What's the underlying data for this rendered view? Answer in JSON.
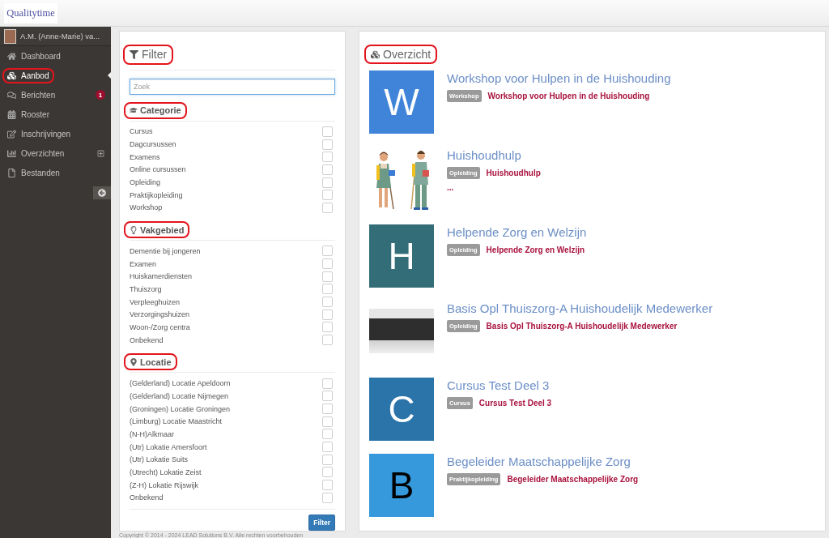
{
  "header": {
    "logo": "Qualitytime"
  },
  "sidebar": {
    "user": {
      "name": "A.M. (Anne-Marie) va..."
    },
    "items": [
      {
        "label": "Dashboard",
        "selected": false,
        "highlighted": false
      },
      {
        "label": "Aanbod",
        "selected": true,
        "highlighted": true
      },
      {
        "label": "Berichten",
        "selected": false,
        "highlighted": false,
        "badge": "1"
      },
      {
        "label": "Rooster",
        "selected": false,
        "highlighted": false
      },
      {
        "label": "Inschrijvingen",
        "selected": false,
        "highlighted": false
      },
      {
        "label": "Overzichten",
        "selected": false,
        "highlighted": false,
        "submenu": {
          "expanded": false
        }
      },
      {
        "label": "Bestanden",
        "selected": false,
        "highlighted": false
      }
    ]
  },
  "filter": {
    "title": "Filter",
    "highlighted": true,
    "search": {
      "placeholder": "Zoek",
      "focused": true
    },
    "sections": [
      {
        "title": "Categorie",
        "highlighted": true,
        "options": [
          {
            "label": "Cursus",
            "checked": false
          },
          {
            "label": "Dagcursussen",
            "checked": false
          },
          {
            "label": "Examens",
            "checked": false
          },
          {
            "label": "Online cursussen",
            "checked": false
          },
          {
            "label": "Opleiding",
            "checked": false
          },
          {
            "label": "Praktijkopleiding",
            "checked": false
          },
          {
            "label": "Workshop",
            "checked": false
          }
        ]
      },
      {
        "title": "Vakgebied",
        "highlighted": true,
        "options": [
          {
            "label": "Dementie bij jongeren",
            "checked": false
          },
          {
            "label": "Examen",
            "checked": false
          },
          {
            "label": "Huiskamerdiensten",
            "checked": false
          },
          {
            "label": "Thuiszorg",
            "checked": false
          },
          {
            "label": "Verpleeghuizen",
            "checked": false
          },
          {
            "label": "Verzorgingshuizen",
            "checked": false
          },
          {
            "label": "Woon-/Zorg centra",
            "checked": false
          },
          {
            "label": "Onbekend",
            "checked": false
          }
        ]
      },
      {
        "title": "Locatie",
        "highlighted": true,
        "options": [
          {
            "label": "(Gelderland) Locatie Apeldoorn",
            "checked": false
          },
          {
            "label": "(Gelderland) Locatie Nijmegen",
            "checked": false
          },
          {
            "label": "(Groningen) Locatie Groningen",
            "checked": false
          },
          {
            "label": "(Limburg) Locatie Maastricht",
            "checked": false
          },
          {
            "label": "(N-H)Alkmaar",
            "checked": false
          },
          {
            "label": "(Utr) Lokatie Amersfoort",
            "checked": false
          },
          {
            "label": "(Utr) Lokatie Suits",
            "checked": false
          },
          {
            "label": "(Utrecht) Lokatie Zeist",
            "checked": false
          },
          {
            "label": "(Z-H) Lokatie Rijswijk",
            "checked": false
          },
          {
            "label": "Onbekend",
            "checked": false
          }
        ]
      }
    ],
    "button": "Filter"
  },
  "overview": {
    "title": "Overzicht",
    "highlighted": true,
    "items": [
      {
        "thumbnail": {
          "kind": "letter",
          "letter": "W",
          "color": "#3f84d9",
          "dark_letter": false
        },
        "title": "Workshop voor Hulpen in de Huishouding",
        "badge": "Workshop",
        "link": "Workshop voor Hulpen in de Huishouding"
      },
      {
        "thumbnail": {
          "kind": "illustration"
        },
        "title": "Huishoudhulp",
        "badge": "Opleiding",
        "link": "Huishoudhulp",
        "excerpt": "..."
      },
      {
        "thumbnail": {
          "kind": "letter",
          "letter": "H",
          "color": "#336e78",
          "dark_letter": false
        },
        "title": "Helpende Zorg en Welzijn",
        "badge": "Opleiding",
        "link": "Helpende Zorg en Welzijn"
      },
      {
        "thumbnail": {
          "kind": "photo"
        },
        "title": "Basis Opl Thuiszorg-A Huishoudelijk Medewerker",
        "badge": "Opleiding",
        "link": "Basis Opl Thuiszorg-A Huishoudelijk Medewerker"
      },
      {
        "thumbnail": {
          "kind": "letter",
          "letter": "C",
          "color": "#2a74a9",
          "dark_letter": false
        },
        "title": "Cursus Test Deel 3",
        "badge": "Cursus",
        "link": "Cursus Test Deel 3"
      },
      {
        "thumbnail": {
          "kind": "letter",
          "letter": "B",
          "color": "#3599dc",
          "dark_letter": true
        },
        "title": "Begeleider Maatschappelijke Zorg",
        "badge": "Praktijkopleiding",
        "link": "Begeleider Maatschappelijke Zorg"
      }
    ]
  },
  "footer": "Copyright © 2014 - 2024 LEAD Solutions B.V. Alle rechten voorbehouden"
}
